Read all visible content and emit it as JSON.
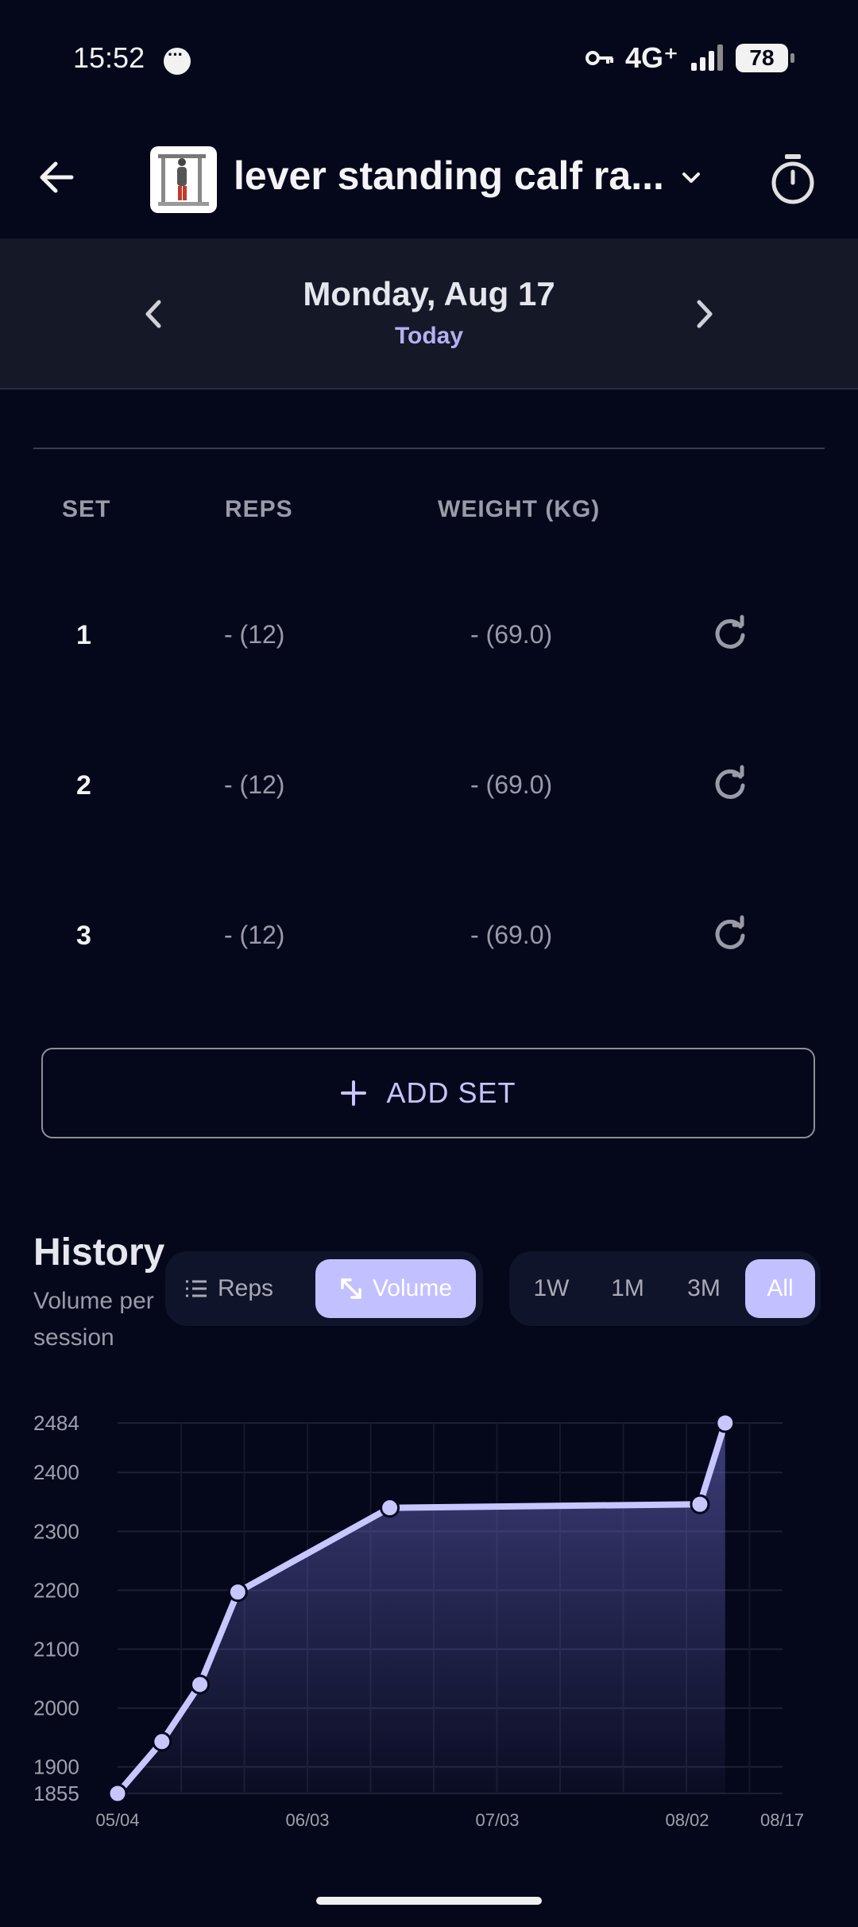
{
  "status_bar": {
    "time": "15:52",
    "network": "4G⁺",
    "battery": "78"
  },
  "header": {
    "exercise_title": "lever standing calf ra...",
    "icons": [
      "back-arrow-icon",
      "dropdown-chevron-icon",
      "timer-icon"
    ]
  },
  "date_nav": {
    "date": "Monday, Aug 17",
    "relative": "Today"
  },
  "sets_table": {
    "headers": [
      "SET",
      "REPS",
      "WEIGHT (KG)"
    ],
    "rows": [
      {
        "set": "1",
        "reps": "- (12)",
        "weight": "- (69.0)"
      },
      {
        "set": "2",
        "reps": "- (12)",
        "weight": "- (69.0)"
      },
      {
        "set": "3",
        "reps": "- (12)",
        "weight": "- (69.0)"
      }
    ]
  },
  "add_set_label": "ADD SET",
  "history": {
    "title": "History",
    "subtitle": "Volume per session",
    "metric_tabs": [
      {
        "label": "Reps",
        "selected": false
      },
      {
        "label": "Volume",
        "selected": true
      }
    ],
    "range_tabs": [
      {
        "label": "1W",
        "selected": false
      },
      {
        "label": "1M",
        "selected": false
      },
      {
        "label": "3M",
        "selected": false
      },
      {
        "label": "All",
        "selected": true
      }
    ]
  },
  "colors": {
    "background": "#05081a",
    "accent": "#c3c0ff",
    "line": "#c8c6ff"
  },
  "chart_data": {
    "type": "area",
    "x": [
      "05/04",
      "05/11",
      "05/17",
      "05/23",
      "06/16",
      "08/04",
      "08/08"
    ],
    "values": [
      1855,
      1943,
      2040,
      2197,
      2340,
      2346,
      2484
    ],
    "x_ticks": [
      "05/04",
      "06/03",
      "07/03",
      "08/02",
      "08/17"
    ],
    "y_ticks": [
      "2484",
      "2400",
      "2300",
      "2200",
      "2100",
      "2000",
      "1900",
      "1855"
    ],
    "ylim": [
      1855,
      2484
    ],
    "grid": true
  }
}
